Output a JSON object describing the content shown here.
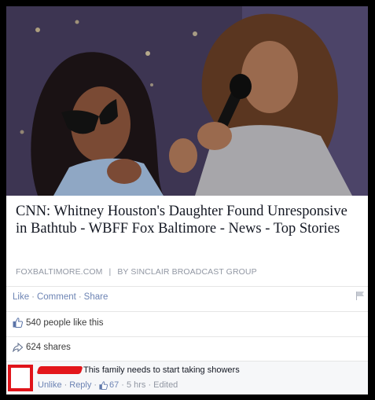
{
  "post": {
    "headline": "CNN: Whitney Houston's Daughter Found Unresponsive in Bathtub - WBFF Fox Baltimore - News - Top Stories",
    "source_domain": "FOXBALTIMORE.COM",
    "source_separator": "|",
    "source_author": "BY SINCLAIR BROADCAST GROUP"
  },
  "actions": {
    "like": "Like",
    "comment": "Comment",
    "share": "Share",
    "dot": "·"
  },
  "stats": {
    "likes": "540 people like this",
    "shares": "624 shares"
  },
  "comment": {
    "text": "This family needs to start taking showers",
    "unlike": "Unlike",
    "reply": "Reply",
    "like_count": "67",
    "time": "5 hrs",
    "edited": "Edited",
    "dot": "·"
  },
  "colors": {
    "link": "#6d84b4",
    "redaction": "#e3161b",
    "border": "#000000"
  }
}
